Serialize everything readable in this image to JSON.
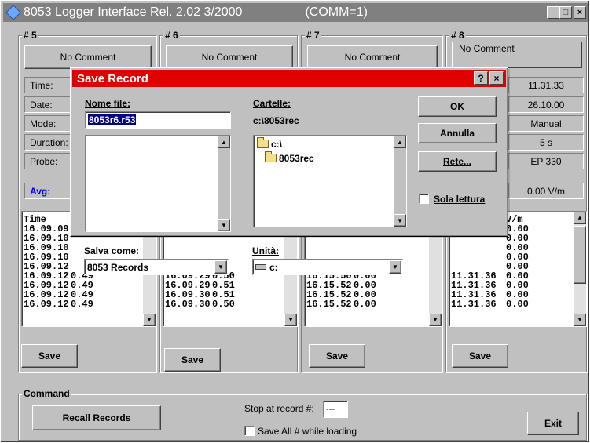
{
  "window": {
    "title": "8053 Logger Interface Rel. 2.02 3/2000",
    "comm": "(COMM=1)",
    "buttons": {
      "minimize": "_",
      "maximize": "□",
      "close": "×"
    }
  },
  "panels": [
    {
      "label": "# 5",
      "comment": "No Comment",
      "save_label": "Save",
      "rows": [
        [
          "Time",
          "",
          "hdr"
        ],
        [
          "16.09.09",
          ""
        ],
        [
          "16.09.10",
          ""
        ],
        [
          "16.09.10",
          ""
        ],
        [
          "16.09.10",
          ""
        ],
        [
          "16.09.12",
          ""
        ],
        [
          "16.09.12",
          "0.49"
        ],
        [
          "16.09.12",
          "0.49"
        ],
        [
          "16.09.12",
          "0.49"
        ],
        [
          "16.09.12",
          "0.49"
        ]
      ]
    },
    {
      "label": "# 6",
      "comment": "No Comment",
      "save_label": "Save",
      "rows": [
        [
          "",
          ""
        ],
        [
          "",
          ""
        ],
        [
          "",
          ""
        ],
        [
          "",
          ""
        ],
        [
          "",
          ""
        ],
        [
          "",
          ""
        ],
        [
          "16.09.29",
          "0.50"
        ],
        [
          "16.09.29",
          "0.51"
        ],
        [
          "16.09.30",
          "0.51"
        ],
        [
          "16.09.30",
          "0.50"
        ]
      ]
    },
    {
      "label": "# 7",
      "comment": "No Comment",
      "save_label": "Save",
      "rows": [
        [
          "",
          ""
        ],
        [
          "",
          ""
        ],
        [
          "",
          ""
        ],
        [
          "",
          ""
        ],
        [
          "",
          ""
        ],
        [
          "",
          ""
        ],
        [
          "16.15.50",
          "0.00"
        ],
        [
          "16.15.52",
          "0.00"
        ],
        [
          "16.15.52",
          "0.00"
        ],
        [
          "16.15.52",
          "0.00"
        ]
      ]
    },
    {
      "label": "# 8",
      "comment": "No Comment",
      "save_label": "Save",
      "rows": [
        [
          "",
          "V/m"
        ],
        [
          "",
          "0.00"
        ],
        [
          "",
          "0.00"
        ],
        [
          "",
          "0.00"
        ],
        [
          "",
          "0.00"
        ],
        [
          "",
          "0.00"
        ],
        [
          "11.31.36",
          "0.00"
        ],
        [
          "11.31.36",
          "0.00"
        ],
        [
          "11.31.36",
          "0.00"
        ],
        [
          "11.31.36",
          "0.00"
        ]
      ]
    }
  ],
  "left_fields": {
    "time": "Time:",
    "date": "Date:",
    "mode": "Mode:",
    "duration": "Duration:",
    "probe": "Probe:",
    "avg": "Avg:"
  },
  "right_fields": {
    "time": "11.31.33",
    "date": "26.10.00",
    "mode": "Manual",
    "duration": "5 s",
    "probe": "EP 330",
    "avg": "0.00 V/m"
  },
  "dialog": {
    "title": "Save Record",
    "help": "?",
    "close": "×",
    "filename_label": "Nome file:",
    "filename_value": "8053r6.r53",
    "folders_label": "Cartelle:",
    "current_path": "c:\\8053rec",
    "folders": [
      "c:\\",
      "8053rec"
    ],
    "save_as_label": "Salva come:",
    "save_as_value": "8053 Records",
    "drives_label": "Unità:",
    "drive_value": "c:",
    "ok": "OK",
    "cancel": "Annulla",
    "network": "Rete...",
    "readonly": "Sola lettura"
  },
  "command": {
    "label": "Command",
    "recall": "Recall Records",
    "stop_label": "Stop at record #:",
    "stop_value": "---",
    "save_all": "Save All # while loading",
    "exit": "Exit"
  },
  "colors": {
    "dialog_title": "#e00000",
    "avg": "#0000ff",
    "face": "#c0c0c0"
  }
}
